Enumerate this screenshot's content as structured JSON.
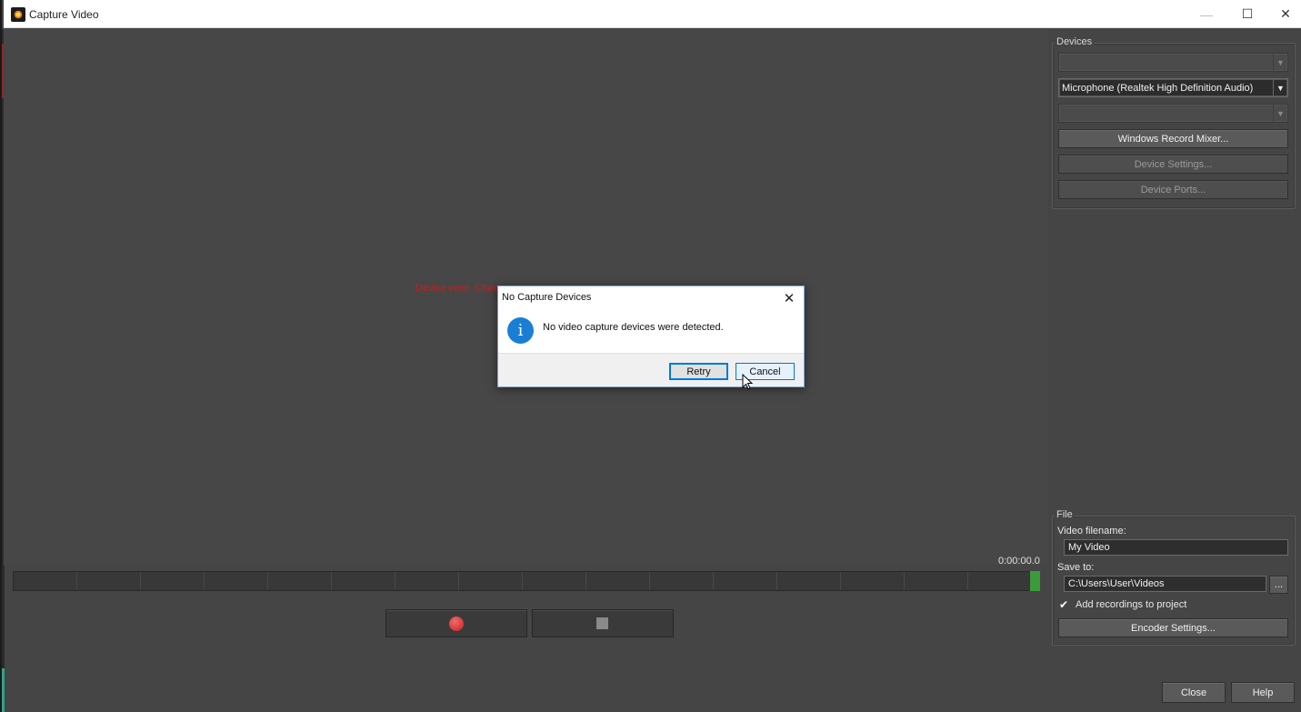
{
  "window": {
    "title": "Capture Video"
  },
  "titlebar": {
    "minimize": "—",
    "maximize": "☐",
    "close": "✕"
  },
  "preview": {
    "error_text": "Device error. Chec"
  },
  "devices": {
    "group_label": "Devices",
    "video_combo": "",
    "audio_combo": "Microphone (Realtek High Definition Audio)",
    "third_combo": "",
    "record_mixer_button": "Windows Record Mixer...",
    "device_settings_button": "Device Settings...",
    "device_ports_button": "Device Ports..."
  },
  "file": {
    "group_label": "File",
    "filename_label": "Video filename:",
    "filename_value": "My Video",
    "save_to_label": "Save to:",
    "save_to_value": "C:\\Users\\User\\Videos",
    "browse_button": "...",
    "add_recordings_label": "Add recordings to project",
    "add_recordings_checked": true,
    "encoder_settings_button": "Encoder Settings..."
  },
  "timeline": {
    "timecode": "0:00:00.0"
  },
  "footer": {
    "close_button": "Close",
    "help_button": "Help"
  },
  "dialog": {
    "title": "No Capture Devices",
    "message": "No video capture devices were detected.",
    "retry_button": "Retry",
    "cancel_button": "Cancel",
    "icon": "info-icon"
  },
  "colors": {
    "record": "#c82020",
    "level_meter": "#3a9b3a",
    "dialog_accent": "#0078d7"
  }
}
